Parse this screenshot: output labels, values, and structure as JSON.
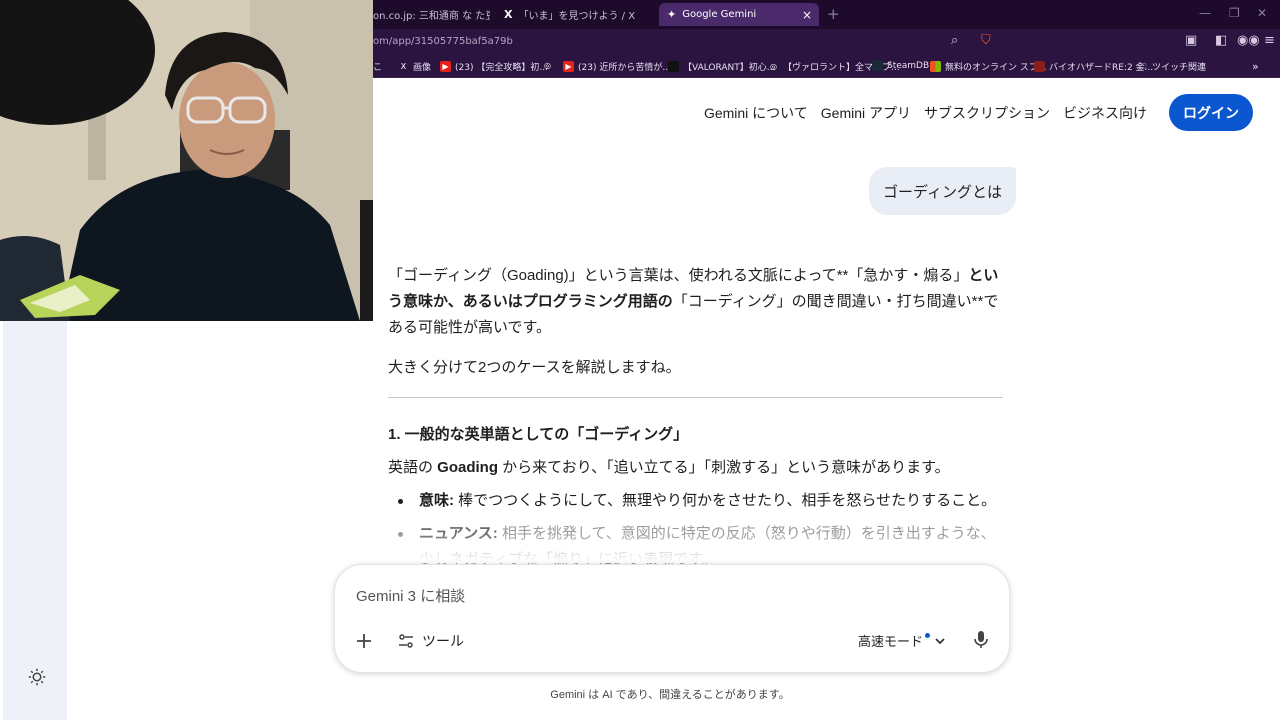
{
  "browser": {
    "tabs": [
      {
        "label": "on.co.jp: 三和通商 な た豆すっき!",
        "icon": ""
      },
      {
        "label": "「いま」を見つけよう / X",
        "icon": "X"
      },
      {
        "label": "Google Gemini",
        "icon": "✦",
        "active": true
      }
    ],
    "url": "om/app/31505775baf5a79b",
    "bookmarks": [
      {
        "label": "こ",
        "icon": ""
      },
      {
        "label": "画像",
        "icon": "X"
      },
      {
        "label": "(23) 【完全攻略】初...",
        "icon": "▶"
      },
      {
        "label": "",
        "icon": "◎"
      },
      {
        "label": "(23) 近所から苦情が...",
        "icon": "▶"
      },
      {
        "label": "【VALORANT】初心...",
        "icon": ""
      },
      {
        "label": "【ヴァロラント】全マップ...",
        "icon": "◎"
      },
      {
        "label": "SteamDB",
        "icon": ""
      },
      {
        "label": "無料のオンライン スプ...",
        "icon": ""
      },
      {
        "label": "バイオハザードRE:2 金...",
        "icon": ""
      },
      {
        "label": "ツイッチ関連",
        "icon": "🗀"
      },
      {
        "label": "»",
        "icon": ""
      }
    ]
  },
  "nav": {
    "links": [
      "Gemini について",
      "Gemini アプリ",
      "サブスクリプション",
      "ビジネス向け"
    ],
    "login": "ログイン"
  },
  "chat": {
    "user_message": "ゴーディングとは",
    "intro": {
      "p1": "「ゴーディング（Goading)」という言葉は、使われる文脈によって**「急かす・煽る」",
      "b1": "という意味か、あるいはプログラミング用語の",
      "p2": "「コーディング」の聞き間違い・打ち間違い**である可能性が高いです。"
    },
    "summary": "大きく分けて2つのケースを解説しますね。",
    "section1": {
      "heading": "1. 一般的な英単語としての「ゴーディング」",
      "desc_pre": "英語の ",
      "desc_bold": "Goading",
      "desc_post": " から来ており、「追い立てる」「刺激する」という意味があります。",
      "bullets": [
        {
          "term": "意味:",
          "text": " 棒でつつくようにして、無理やり何かをさせたり、相手を怒らせたりすること。"
        },
        {
          "term": "ニュアンス:",
          "text": " 相手を挑発して、意図的に特定の反応（怒りや行動）を引き出すような、少しネガティブな「煽り」に近い表現です。"
        }
      ]
    }
  },
  "composer": {
    "placeholder": "Gemini 3 に相談",
    "tools_label": "ツール",
    "mode_label": "高速モード"
  },
  "footer": {
    "disclaimer": "Gemini は AI であり、間違えることがあります。"
  },
  "colors": {
    "accent": "#0b57d0",
    "tab_bar": "#1e0b2c",
    "toolbar": "#2b1440",
    "user_bubble": "#e9eef6"
  }
}
